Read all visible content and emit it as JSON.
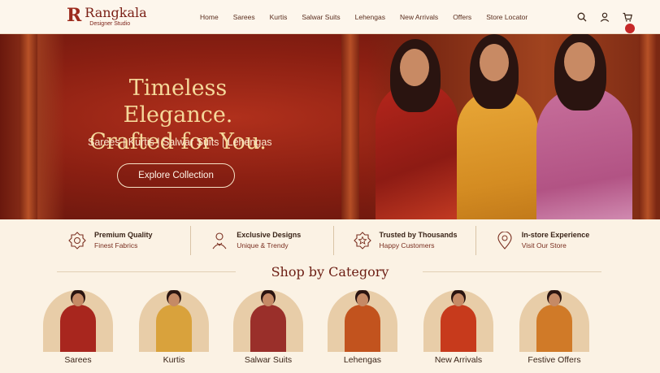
{
  "brand": {
    "mark": "R",
    "name": "Rangkala",
    "tagline": "Designer Studio"
  },
  "nav": [
    "Home",
    "Sarees",
    "Kurtis",
    "Salwar Suits",
    "Lehengas",
    "New Arrivals",
    "Offers",
    "Store Locator"
  ],
  "icons": {
    "search": "search-icon",
    "account": "user-icon",
    "cart": "cart-icon"
  },
  "hero": {
    "title_line1": "Timeless Elegance.",
    "title_line2": "Crafted for You.",
    "subtitle": "Sarees | Kurtis | Salwar Suits | Lehengas",
    "cta": "Explore Collection"
  },
  "features": [
    {
      "title": "Premium Quality",
      "subtitle": "Finest Fabrics",
      "icon": "badge-icon"
    },
    {
      "title": "Exclusive Designs",
      "subtitle": "Unique & Trendy",
      "icon": "designer-icon"
    },
    {
      "title": "Trusted by Thousands",
      "subtitle": "Happy Customers",
      "icon": "star-badge-icon"
    },
    {
      "title": "In-store Experience",
      "subtitle": "Visit Our Store",
      "icon": "location-icon"
    }
  ],
  "category_heading": "Shop by Category",
  "categories": [
    {
      "label": "Sarees",
      "color": "#a8261e"
    },
    {
      "label": "Kurtis",
      "color": "#d9a23c"
    },
    {
      "label": "Salwar Suits",
      "color": "#9a2f2a"
    },
    {
      "label": "Lehengas",
      "color": "#c2531e"
    },
    {
      "label": "New Arrivals",
      "color": "#c73a1c"
    },
    {
      "label": "Festive Offers",
      "color": "#d07a28"
    }
  ],
  "colors": {
    "accent": "#7a1f15",
    "hero_bg": "#8a1f12",
    "gold": "#f5d89a",
    "cart_badge": "#c62828"
  }
}
